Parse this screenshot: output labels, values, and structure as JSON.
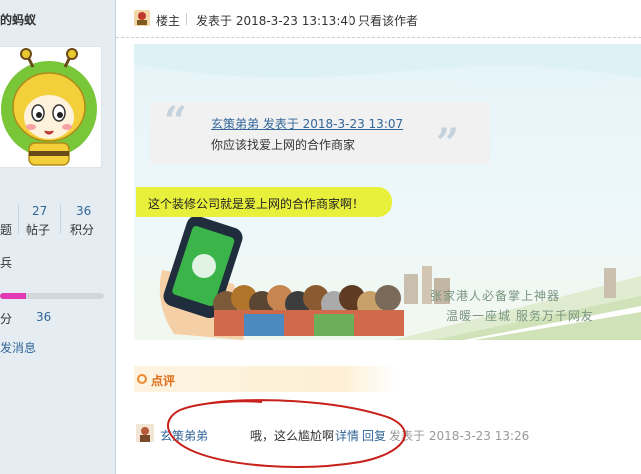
{
  "sidebar": {
    "user_name": "的蚂蚁",
    "stats": [
      {
        "value": "",
        "label": "题"
      },
      {
        "value": "27",
        "label": "帖子"
      },
      {
        "value": "36",
        "label": "积分"
      }
    ],
    "level_text": "兵",
    "progress": 0.25,
    "points_label": "分",
    "points_value": "36",
    "send_message": "发消息"
  },
  "post": {
    "role": "楼主",
    "posted_at": "发表于 2018-3-23 13:13:40",
    "only_author": "只看该作者"
  },
  "quote": {
    "author": "玄策弟弟 发表于 2018-3-23 13:07",
    "text": "你应该找爱上网的合作商家"
  },
  "reply_text": "这个装修公司就是爱上网的合作商家啊！",
  "banner": {
    "slogan_1": "张家港人必备掌上神器",
    "slogan_2": "温暖一座城 服务万千网友"
  },
  "rating": {
    "label": "点评",
    "user": "玄策弟弟",
    "comment": "哦，这么尴尬啊",
    "detail": "详情",
    "reply": "回复",
    "time": "发表于 2018-3-23 13:26"
  },
  "colors": {
    "link": "#336699",
    "accent_orange": "#e06d1a",
    "progress": "#e23ab5",
    "highlight": "#e8f03c",
    "annotation_red": "#c8201a"
  },
  "icons": [
    "quote-open-icon",
    "quote-close-icon",
    "op-badge-icon",
    "user-avatar-icon",
    "comment-circle-icon"
  ]
}
